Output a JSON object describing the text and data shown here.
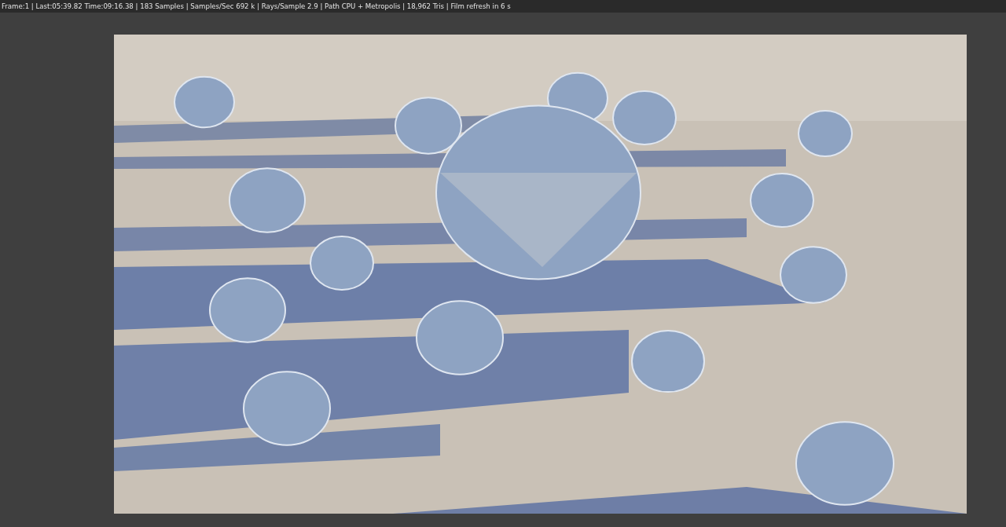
{
  "status_bar": {
    "text": "Frame:1 | Last:05:39.82 Time:09:16.38 | 183 Samples | Samples/Sec 692 k | Rays/Sample 2.9 | Path CPU + Metropolis | 18,962 Tris | Film refresh in 6 s"
  }
}
